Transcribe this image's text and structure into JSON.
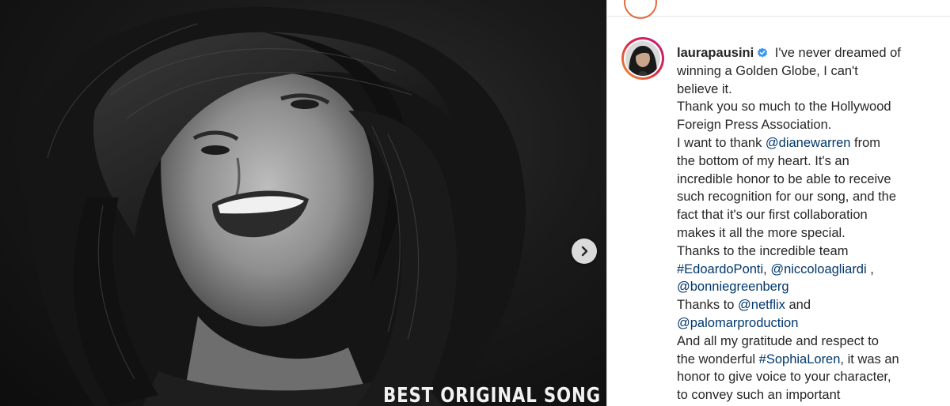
{
  "post": {
    "image": {
      "caption_text": "BEST ORIGINAL SONG"
    },
    "author": {
      "username": "laurapausini",
      "verified": true
    },
    "caption": {
      "line1": " I've never dreamed of",
      "line2": "winning a Golden Globe, I can't",
      "line3": "believe it.",
      "line4": "Thank you so much to the Hollywood",
      "line5": "Foreign Press Association.",
      "line6_pre": "I want to thank ",
      "line6_link": "@dianewarren",
      "line6_post": " from",
      "line7": "the bottom of my heart. It's an",
      "line8": "incredible honor to be able to receive",
      "line9": "such recognition for our song, and the",
      "line10": "fact that it's our first collaboration",
      "line11": "makes it all the more special.",
      "line12": "Thanks to the incredible team",
      "line13_link1": "#EdoardoPonti",
      "line13_sep": ", ",
      "line13_link2": "@niccoloagliardi",
      "line13_post": " ,",
      "line14_link": "@bonniegreenberg",
      "line15_pre": "Thanks to ",
      "line15_link": "@netflix",
      "line15_post": " and",
      "line16_link": "@palomarproduction",
      "line17": "And all my gratitude and respect to",
      "line18_pre": "the wonderful ",
      "line18_link": "#SophiaLoren",
      "line18_post": ", it was an",
      "line19": "honor to give voice to your character,",
      "line20": "to convey such an important"
    }
  },
  "colors": {
    "link": "#00376b",
    "text": "#262626",
    "verified_badge": "#3897f0",
    "story_ring_start": "#f09433",
    "story_ring_end": "#bc1888"
  },
  "icons": {
    "next": "chevron-right-icon",
    "verified": "verified-badge-icon"
  }
}
